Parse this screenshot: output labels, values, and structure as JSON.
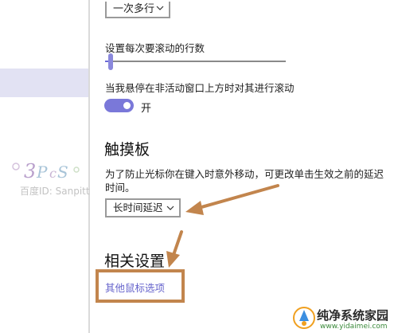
{
  "scroll_lines": {
    "selected": "一次多行"
  },
  "lines_per_scroll": {
    "label": "设置每次要滚动的行数",
    "value_fraction": 0.03
  },
  "inactive_scroll": {
    "label": "当我悬停在非活动窗口上方时对其进行滚动",
    "state_label": "开",
    "on": true
  },
  "touchpad": {
    "title": "触摸板",
    "description": "为了防止光标你在键入时意外移动，可更改单击生效之前的延迟时间。",
    "delay_selected": "长时间延迟"
  },
  "related": {
    "title": "相关设置",
    "link": "其他鼠标选项"
  },
  "watermark": {
    "text": "百度ID: Sanpitt"
  },
  "logo": {
    "main": "纯净系统家园",
    "sub": "www.yidaimei.com"
  },
  "colors": {
    "accent": "#6b69d6",
    "annotation": "#c2854d",
    "link": "#6664cc"
  },
  "icons": [
    "chevron-down-icon",
    "arrow-annotation",
    "logo-badge"
  ]
}
